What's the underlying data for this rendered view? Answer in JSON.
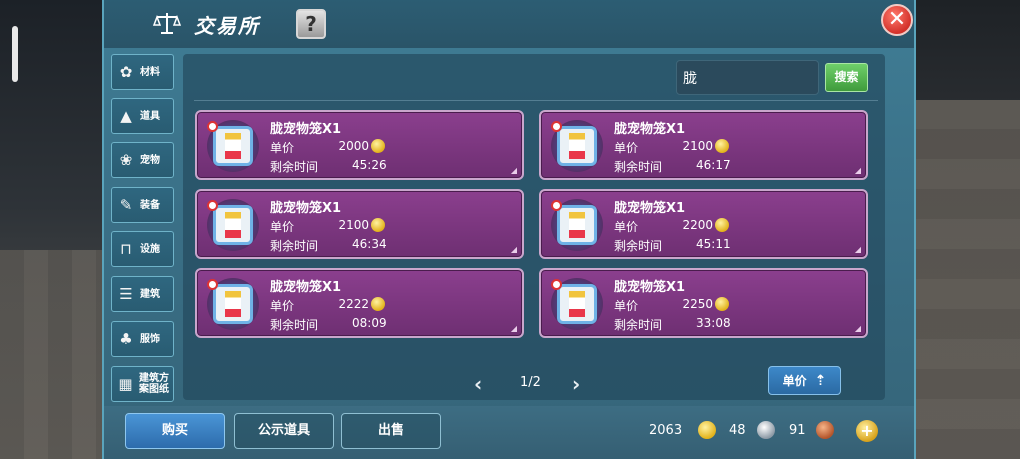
{
  "header": {
    "title": "交易所",
    "help_label": "?",
    "close_label": "✕"
  },
  "sidebar": {
    "items": [
      {
        "label": "材料",
        "icon": "materials-icon"
      },
      {
        "label": "道具",
        "icon": "tools-icon"
      },
      {
        "label": "宠物",
        "icon": "paw-icon"
      },
      {
        "label": "装备",
        "icon": "equipment-icon"
      },
      {
        "label": "设施",
        "icon": "facility-icon"
      },
      {
        "label": "建筑",
        "icon": "building-icon"
      },
      {
        "label": "服饰",
        "icon": "clothing-icon"
      },
      {
        "label": "建筑方案图纸",
        "icon": "blueprint-icon"
      }
    ]
  },
  "search": {
    "value": "胧",
    "button_label": "搜索"
  },
  "listings": [
    {
      "name": "胧宠物笼X1",
      "price_label": "单价",
      "price": "2000",
      "time_label": "剩余时间",
      "time": "45:26"
    },
    {
      "name": "胧宠物笼X1",
      "price_label": "单价",
      "price": "2100",
      "time_label": "剩余时间",
      "time": "46:17"
    },
    {
      "name": "胧宠物笼X1",
      "price_label": "单价",
      "price": "2100",
      "time_label": "剩余时间",
      "time": "46:34"
    },
    {
      "name": "胧宠物笼X1",
      "price_label": "单价",
      "price": "2200",
      "time_label": "剩余时间",
      "time": "45:11"
    },
    {
      "name": "胧宠物笼X1",
      "price_label": "单价",
      "price": "2222",
      "time_label": "剩余时间",
      "time": "08:09"
    },
    {
      "name": "胧宠物笼X1",
      "price_label": "单价",
      "price": "2250",
      "time_label": "剩余时间",
      "time": "33:08"
    }
  ],
  "pager": {
    "prev": "‹",
    "text": "1/2",
    "next": "›"
  },
  "sort": {
    "label": "单价"
  },
  "bottom": {
    "buy_label": "购买",
    "public_label": "公示道具",
    "sell_label": "出售",
    "gold": "2063",
    "silver": "48",
    "copper": "91",
    "add_label": "+"
  },
  "colors": {
    "card": "#7a3480",
    "window": "#3a6f86",
    "accent_green": "#4fae4a",
    "accent_blue": "#3a7fc0"
  }
}
